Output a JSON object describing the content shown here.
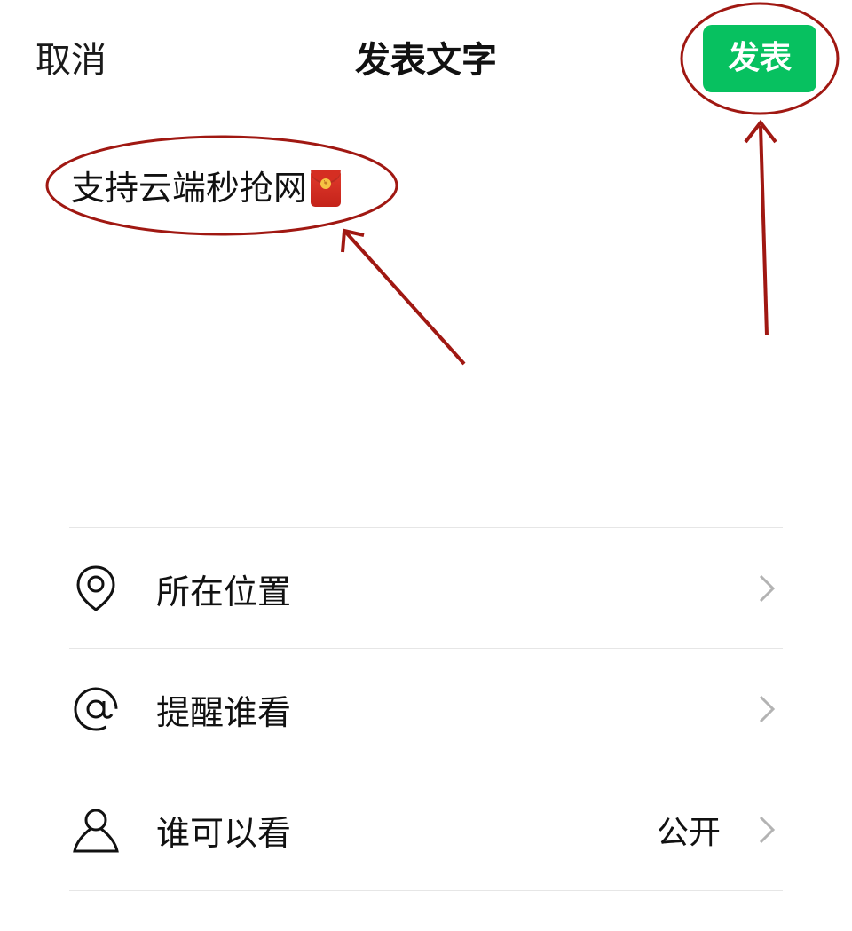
{
  "header": {
    "cancel_label": "取消",
    "title": "发表文字",
    "publish_label": "发表"
  },
  "post": {
    "text": "支持云端秒抢网",
    "emoji": "red-packet-icon"
  },
  "settings": [
    {
      "label": "所在位置",
      "icon": "location-pin-icon",
      "value": ""
    },
    {
      "label": "提醒谁看",
      "icon": "at-sign-icon",
      "value": ""
    },
    {
      "label": "谁可以看",
      "icon": "person-icon",
      "value": "公开"
    }
  ],
  "colors": {
    "accent": "#07c160",
    "annotation": "#a01812",
    "divider": "#e6e6e6",
    "chevron": "#b3b3b3"
  }
}
